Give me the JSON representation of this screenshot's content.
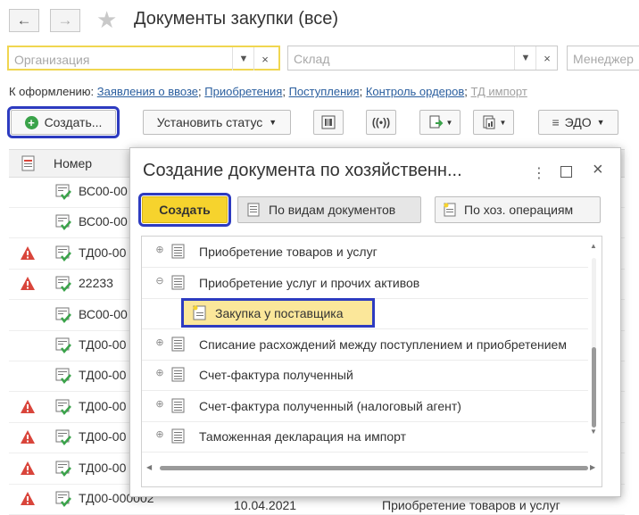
{
  "header": {
    "title": "Документы закупки (все)"
  },
  "filters": {
    "organization_placeholder": "Организация",
    "warehouse_placeholder": "Склад",
    "manager_placeholder": "Менеджер"
  },
  "links": {
    "prefix": "К оформлению:",
    "items": [
      "Заявления о ввозе",
      "Приобретения",
      "Поступления",
      "Контроль ордеров",
      "ТД импорт"
    ]
  },
  "toolbar": {
    "create_label": "Создать...",
    "status_label": "Установить статус",
    "edo_label": "ЭДО"
  },
  "table": {
    "column_number": "Номер",
    "rows": [
      {
        "num": "ВС00-00",
        "warn": false
      },
      {
        "num": "ВС00-00",
        "warn": false
      },
      {
        "num": "ТД00-00",
        "warn": true
      },
      {
        "num": "22233",
        "warn": true
      },
      {
        "num": "ВС00-00",
        "warn": false
      },
      {
        "num": "ТД00-00",
        "warn": false
      },
      {
        "num": "ТД00-00",
        "warn": false
      },
      {
        "num": "ТД00-00",
        "warn": true
      },
      {
        "num": "ТД00-00",
        "warn": true
      },
      {
        "num": "ТД00-00",
        "warn": true
      },
      {
        "num": "ТД00-000002",
        "warn": true
      }
    ],
    "last_row_extra": {
      "date": "10.04.2021",
      "op": "Приобретение товаров и услуг"
    }
  },
  "dialog": {
    "title": "Создание документа по хозяйственн...",
    "create_label": "Создать",
    "tab_by_type": "По видам документов",
    "tab_by_op": "По хоз. операциям",
    "tree": [
      {
        "label": "Приобретение товаров и услуг",
        "sign": "+",
        "indent": 0
      },
      {
        "label": "Приобретение услуг и прочих активов",
        "sign": "−",
        "indent": 0
      },
      {
        "label": "Закупка у поставщика",
        "sign": "",
        "indent": 1
      },
      {
        "label": "Списание расхождений между поступлением и приобретением",
        "sign": "+",
        "indent": 0
      },
      {
        "label": "Счет-фактура полученный",
        "sign": "+",
        "indent": 0
      },
      {
        "label": "Счет-фактура полученный (налоговый агент)",
        "sign": "+",
        "indent": 0
      },
      {
        "label": "Таможенная декларация на импорт",
        "sign": "+",
        "indent": 0
      }
    ]
  },
  "colors": {
    "highlight": "#2d3bc0",
    "create_yellow": "#f6d32d",
    "link": "#2a5e9e",
    "warn_red": "#d9453b",
    "doc_green": "#3aa34a"
  }
}
